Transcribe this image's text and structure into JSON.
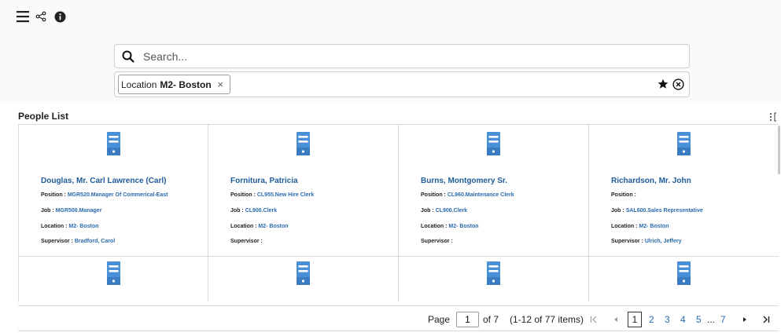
{
  "toolbar": {
    "menu_icon": "hamburger-icon",
    "share_icon": "share-icon",
    "info_icon": "info-icon"
  },
  "search": {
    "placeholder": "Search...",
    "icon": "search-icon"
  },
  "filter": {
    "chip_label": "Location",
    "chip_value": "M2- Boston",
    "chip_close": "×",
    "favorite_icon": "star-icon",
    "clear_icon": "clear-circle-icon"
  },
  "list": {
    "title": "People List",
    "menu_icon": "more-options-icon",
    "field_labels": {
      "position": "Position :",
      "job": "Job :",
      "location": "Location :",
      "supervisor": "Supervisor :"
    },
    "people": [
      {
        "name": "Douglas, Mr. Carl Lawrence (Carl)",
        "position": "MGR520.Manager Of Commerical-East",
        "job": "MGR500.Manager",
        "location": "M2- Boston",
        "supervisor": "Bradford, Carol"
      },
      {
        "name": "Fornitura, Patricia",
        "position": "CL955.New Hire Clerk",
        "job": "CL900.Clerk",
        "location": "M2- Boston",
        "supervisor": ""
      },
      {
        "name": "Burns, Montgomery Sr.",
        "position": "CL960.Maintenance Clerk",
        "job": "CL900.Clerk",
        "location": "M2- Boston",
        "supervisor": ""
      },
      {
        "name": "Richardson, Mr. John",
        "position": "",
        "job": "SAL600.Sales Representative",
        "location": "M2- Boston",
        "supervisor": "Ulrich, Jeffery"
      }
    ]
  },
  "pager": {
    "page_label": "Page",
    "current_page": "1",
    "of_label": "of 7",
    "range_label": "(1-12 of 77 items)",
    "pages": [
      "1",
      "2",
      "3",
      "4",
      "5"
    ],
    "ellipsis": "...",
    "last_page": "7",
    "first_icon": "first-page-icon",
    "prev_icon": "prev-page-icon",
    "next_icon": "next-page-icon",
    "last_icon": "last-page-icon"
  },
  "colors": {
    "link": "#2b6bae",
    "name": "#1f5c99",
    "avatar": "#4a90d9"
  }
}
